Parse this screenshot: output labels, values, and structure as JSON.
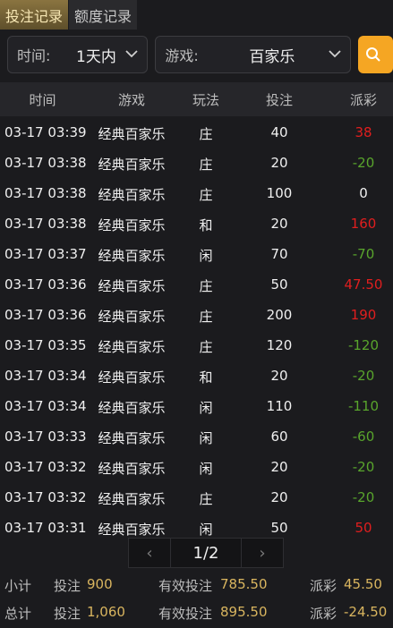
{
  "tabs": [
    {
      "label": "投注记录",
      "active": true
    },
    {
      "label": "额度记录",
      "active": false
    }
  ],
  "filters": {
    "time_label": "时间:",
    "time_value": "1天内",
    "game_label": "游戏:",
    "game_value": "百家乐",
    "search_icon": "search-icon"
  },
  "table": {
    "headers": [
      "时间",
      "游戏",
      "玩法",
      "投注",
      "派彩"
    ],
    "rows": [
      {
        "time": "03-17 03:39",
        "game": "经典百家乐",
        "play": "庄",
        "bet": "40",
        "payout": "38",
        "sign": "pos"
      },
      {
        "time": "03-17 03:38",
        "game": "经典百家乐",
        "play": "庄",
        "bet": "20",
        "payout": "-20",
        "sign": "neg"
      },
      {
        "time": "03-17 03:38",
        "game": "经典百家乐",
        "play": "庄",
        "bet": "100",
        "payout": "0",
        "sign": "zero"
      },
      {
        "time": "03-17 03:38",
        "game": "经典百家乐",
        "play": "和",
        "bet": "20",
        "payout": "160",
        "sign": "pos"
      },
      {
        "time": "03-17 03:37",
        "game": "经典百家乐",
        "play": "闲",
        "bet": "70",
        "payout": "-70",
        "sign": "neg"
      },
      {
        "time": "03-17 03:36",
        "game": "经典百家乐",
        "play": "庄",
        "bet": "50",
        "payout": "47.50",
        "sign": "pos"
      },
      {
        "time": "03-17 03:36",
        "game": "经典百家乐",
        "play": "庄",
        "bet": "200",
        "payout": "190",
        "sign": "pos"
      },
      {
        "time": "03-17 03:35",
        "game": "经典百家乐",
        "play": "庄",
        "bet": "120",
        "payout": "-120",
        "sign": "neg"
      },
      {
        "time": "03-17 03:34",
        "game": "经典百家乐",
        "play": "和",
        "bet": "20",
        "payout": "-20",
        "sign": "neg"
      },
      {
        "time": "03-17 03:34",
        "game": "经典百家乐",
        "play": "闲",
        "bet": "110",
        "payout": "-110",
        "sign": "neg"
      },
      {
        "time": "03-17 03:33",
        "game": "经典百家乐",
        "play": "闲",
        "bet": "60",
        "payout": "-60",
        "sign": "neg"
      },
      {
        "time": "03-17 03:32",
        "game": "经典百家乐",
        "play": "闲",
        "bet": "20",
        "payout": "-20",
        "sign": "neg"
      },
      {
        "time": "03-17 03:32",
        "game": "经典百家乐",
        "play": "庄",
        "bet": "20",
        "payout": "-20",
        "sign": "neg"
      },
      {
        "time": "03-17 03:31",
        "game": "经典百家乐",
        "play": "闲",
        "bet": "50",
        "payout": "50",
        "sign": "pos"
      }
    ]
  },
  "pager": {
    "prev": "‹",
    "page": "1/2",
    "next": "›"
  },
  "subtotal": {
    "label": "小计",
    "bet_label": "投注",
    "bet_value": "900",
    "effective_label": "有效投注",
    "effective_value": "785.50",
    "payout_label": "派彩",
    "payout_value": "45.50"
  },
  "total": {
    "label": "总计",
    "bet_label": "投注",
    "bet_value": "1,060",
    "effective_label": "有效投注",
    "effective_value": "895.50",
    "payout_label": "派彩",
    "payout_value": "-24.50"
  },
  "colors": {
    "accent": "#f5a623",
    "positive": "#e01e1e",
    "negative": "#59a52c",
    "summary_value": "#d9b55f"
  }
}
